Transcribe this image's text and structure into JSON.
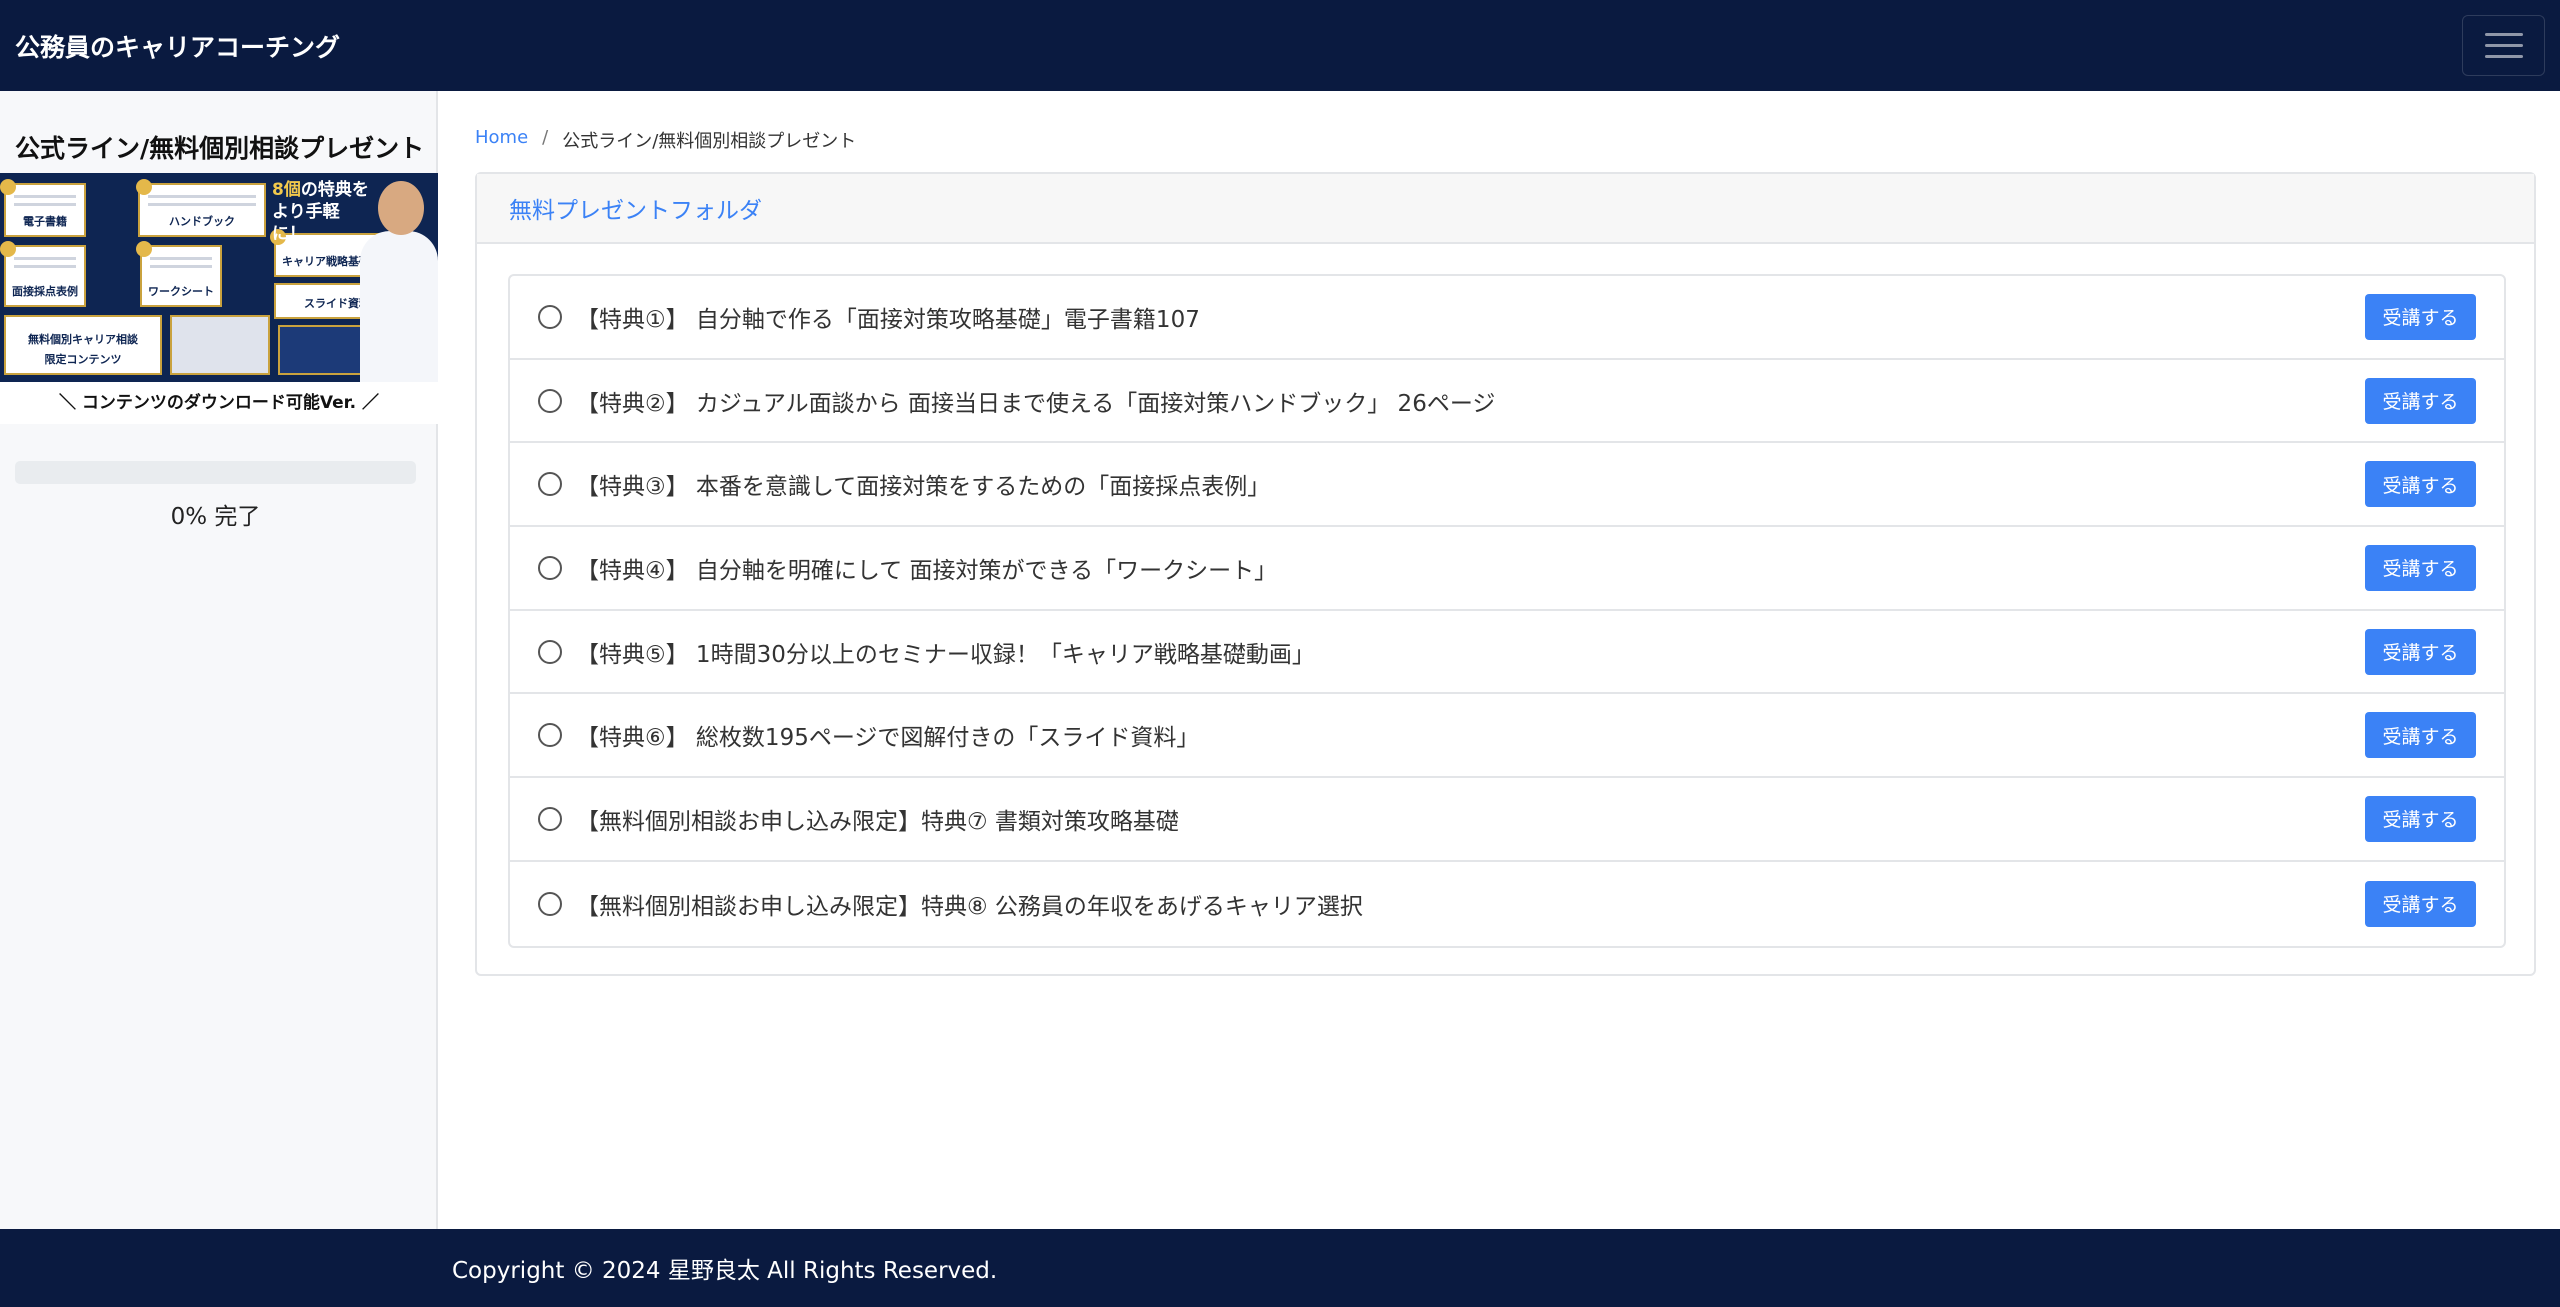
{
  "header": {
    "brand": "公務員のキャリアコーチング"
  },
  "sidebar": {
    "title": "公式ライン/無料個別相談プレゼント",
    "banner": {
      "headline_gold": "8個",
      "headline_rest": "の特典を",
      "headline_line2": "より手軽に！",
      "tiles": [
        "電子書籍",
        "ハンドブック",
        "キャリア戦略基礎動画",
        "面接採点表例",
        "ワークシート",
        "スライド資料",
        "無料個別キャリア相談",
        "限定コンテンツ"
      ],
      "caption": "＼ コンテンツのダウンロード可能Ver. ／"
    },
    "progress": {
      "percent": 0,
      "label": "0% 完了"
    }
  },
  "breadcrumb": {
    "home": "Home",
    "separator": "/",
    "current": "公式ライン/無料個別相談プレゼント"
  },
  "folder": {
    "title": "無料プレゼントフォルダ",
    "items": [
      {
        "label": "【特典①】 自分軸で作る「面接対策攻略基礎」電子書籍107",
        "button": "受講する"
      },
      {
        "label": "【特典②】 カジュアル面談から 面接当日まで使える「面接対策ハンドブック」 26ページ",
        "button": "受講する"
      },
      {
        "label": "【特典③】 本番を意識して面接対策をするための「面接採点表例」",
        "button": "受講する"
      },
      {
        "label": "【特典④】 自分軸を明確にして 面接対策ができる「ワークシート」",
        "button": "受講する"
      },
      {
        "label": "【特典⑤】 1時間30分以上のセミナー収録！「キャリア戦略基礎動画」",
        "button": "受講する"
      },
      {
        "label": "【特典⑥】 総枚数195ページで図解付きの「スライド資料」",
        "button": "受講する"
      },
      {
        "label": "【無料個別相談お申し込み限定】特典⑦ 書類対策攻略基礎",
        "button": "受講する"
      },
      {
        "label": "【無料個別相談お申し込み限定】特典⑧ 公務員の年収をあげるキャリア選択",
        "button": "受講する"
      }
    ]
  },
  "footer": {
    "copyright": "Copyright © 2024 星野良太 All Rights Reserved."
  },
  "colors": {
    "navy": "#0a1a40",
    "accent": "#3b82f6"
  }
}
